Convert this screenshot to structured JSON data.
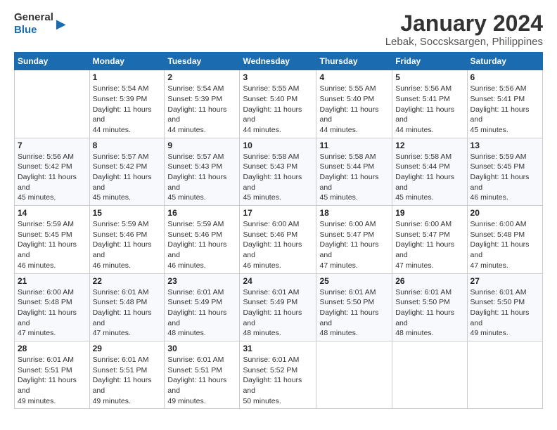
{
  "logo": {
    "general": "General",
    "blue": "Blue"
  },
  "title": "January 2024",
  "subtitle": "Lebak, Soccsksargen, Philippines",
  "days_of_week": [
    "Sunday",
    "Monday",
    "Tuesday",
    "Wednesday",
    "Thursday",
    "Friday",
    "Saturday"
  ],
  "weeks": [
    [
      {
        "day": "",
        "sunrise": "",
        "sunset": "",
        "daylight": ""
      },
      {
        "day": "1",
        "sunrise": "Sunrise: 5:54 AM",
        "sunset": "Sunset: 5:39 PM",
        "daylight": "Daylight: 11 hours and 44 minutes."
      },
      {
        "day": "2",
        "sunrise": "Sunrise: 5:54 AM",
        "sunset": "Sunset: 5:39 PM",
        "daylight": "Daylight: 11 hours and 44 minutes."
      },
      {
        "day": "3",
        "sunrise": "Sunrise: 5:55 AM",
        "sunset": "Sunset: 5:40 PM",
        "daylight": "Daylight: 11 hours and 44 minutes."
      },
      {
        "day": "4",
        "sunrise": "Sunrise: 5:55 AM",
        "sunset": "Sunset: 5:40 PM",
        "daylight": "Daylight: 11 hours and 44 minutes."
      },
      {
        "day": "5",
        "sunrise": "Sunrise: 5:56 AM",
        "sunset": "Sunset: 5:41 PM",
        "daylight": "Daylight: 11 hours and 44 minutes."
      },
      {
        "day": "6",
        "sunrise": "Sunrise: 5:56 AM",
        "sunset": "Sunset: 5:41 PM",
        "daylight": "Daylight: 11 hours and 45 minutes."
      }
    ],
    [
      {
        "day": "7",
        "sunrise": "Sunrise: 5:56 AM",
        "sunset": "Sunset: 5:42 PM",
        "daylight": "Daylight: 11 hours and 45 minutes."
      },
      {
        "day": "8",
        "sunrise": "Sunrise: 5:57 AM",
        "sunset": "Sunset: 5:42 PM",
        "daylight": "Daylight: 11 hours and 45 minutes."
      },
      {
        "day": "9",
        "sunrise": "Sunrise: 5:57 AM",
        "sunset": "Sunset: 5:43 PM",
        "daylight": "Daylight: 11 hours and 45 minutes."
      },
      {
        "day": "10",
        "sunrise": "Sunrise: 5:58 AM",
        "sunset": "Sunset: 5:43 PM",
        "daylight": "Daylight: 11 hours and 45 minutes."
      },
      {
        "day": "11",
        "sunrise": "Sunrise: 5:58 AM",
        "sunset": "Sunset: 5:44 PM",
        "daylight": "Daylight: 11 hours and 45 minutes."
      },
      {
        "day": "12",
        "sunrise": "Sunrise: 5:58 AM",
        "sunset": "Sunset: 5:44 PM",
        "daylight": "Daylight: 11 hours and 45 minutes."
      },
      {
        "day": "13",
        "sunrise": "Sunrise: 5:59 AM",
        "sunset": "Sunset: 5:45 PM",
        "daylight": "Daylight: 11 hours and 46 minutes."
      }
    ],
    [
      {
        "day": "14",
        "sunrise": "Sunrise: 5:59 AM",
        "sunset": "Sunset: 5:45 PM",
        "daylight": "Daylight: 11 hours and 46 minutes."
      },
      {
        "day": "15",
        "sunrise": "Sunrise: 5:59 AM",
        "sunset": "Sunset: 5:46 PM",
        "daylight": "Daylight: 11 hours and 46 minutes."
      },
      {
        "day": "16",
        "sunrise": "Sunrise: 5:59 AM",
        "sunset": "Sunset: 5:46 PM",
        "daylight": "Daylight: 11 hours and 46 minutes."
      },
      {
        "day": "17",
        "sunrise": "Sunrise: 6:00 AM",
        "sunset": "Sunset: 5:46 PM",
        "daylight": "Daylight: 11 hours and 46 minutes."
      },
      {
        "day": "18",
        "sunrise": "Sunrise: 6:00 AM",
        "sunset": "Sunset: 5:47 PM",
        "daylight": "Daylight: 11 hours and 47 minutes."
      },
      {
        "day": "19",
        "sunrise": "Sunrise: 6:00 AM",
        "sunset": "Sunset: 5:47 PM",
        "daylight": "Daylight: 11 hours and 47 minutes."
      },
      {
        "day": "20",
        "sunrise": "Sunrise: 6:00 AM",
        "sunset": "Sunset: 5:48 PM",
        "daylight": "Daylight: 11 hours and 47 minutes."
      }
    ],
    [
      {
        "day": "21",
        "sunrise": "Sunrise: 6:00 AM",
        "sunset": "Sunset: 5:48 PM",
        "daylight": "Daylight: 11 hours and 47 minutes."
      },
      {
        "day": "22",
        "sunrise": "Sunrise: 6:01 AM",
        "sunset": "Sunset: 5:48 PM",
        "daylight": "Daylight: 11 hours and 47 minutes."
      },
      {
        "day": "23",
        "sunrise": "Sunrise: 6:01 AM",
        "sunset": "Sunset: 5:49 PM",
        "daylight": "Daylight: 11 hours and 48 minutes."
      },
      {
        "day": "24",
        "sunrise": "Sunrise: 6:01 AM",
        "sunset": "Sunset: 5:49 PM",
        "daylight": "Daylight: 11 hours and 48 minutes."
      },
      {
        "day": "25",
        "sunrise": "Sunrise: 6:01 AM",
        "sunset": "Sunset: 5:50 PM",
        "daylight": "Daylight: 11 hours and 48 minutes."
      },
      {
        "day": "26",
        "sunrise": "Sunrise: 6:01 AM",
        "sunset": "Sunset: 5:50 PM",
        "daylight": "Daylight: 11 hours and 48 minutes."
      },
      {
        "day": "27",
        "sunrise": "Sunrise: 6:01 AM",
        "sunset": "Sunset: 5:50 PM",
        "daylight": "Daylight: 11 hours and 49 minutes."
      }
    ],
    [
      {
        "day": "28",
        "sunrise": "Sunrise: 6:01 AM",
        "sunset": "Sunset: 5:51 PM",
        "daylight": "Daylight: 11 hours and 49 minutes."
      },
      {
        "day": "29",
        "sunrise": "Sunrise: 6:01 AM",
        "sunset": "Sunset: 5:51 PM",
        "daylight": "Daylight: 11 hours and 49 minutes."
      },
      {
        "day": "30",
        "sunrise": "Sunrise: 6:01 AM",
        "sunset": "Sunset: 5:51 PM",
        "daylight": "Daylight: 11 hours and 49 minutes."
      },
      {
        "day": "31",
        "sunrise": "Sunrise: 6:01 AM",
        "sunset": "Sunset: 5:52 PM",
        "daylight": "Daylight: 11 hours and 50 minutes."
      },
      {
        "day": "",
        "sunrise": "",
        "sunset": "",
        "daylight": ""
      },
      {
        "day": "",
        "sunrise": "",
        "sunset": "",
        "daylight": ""
      },
      {
        "day": "",
        "sunrise": "",
        "sunset": "",
        "daylight": ""
      }
    ]
  ]
}
